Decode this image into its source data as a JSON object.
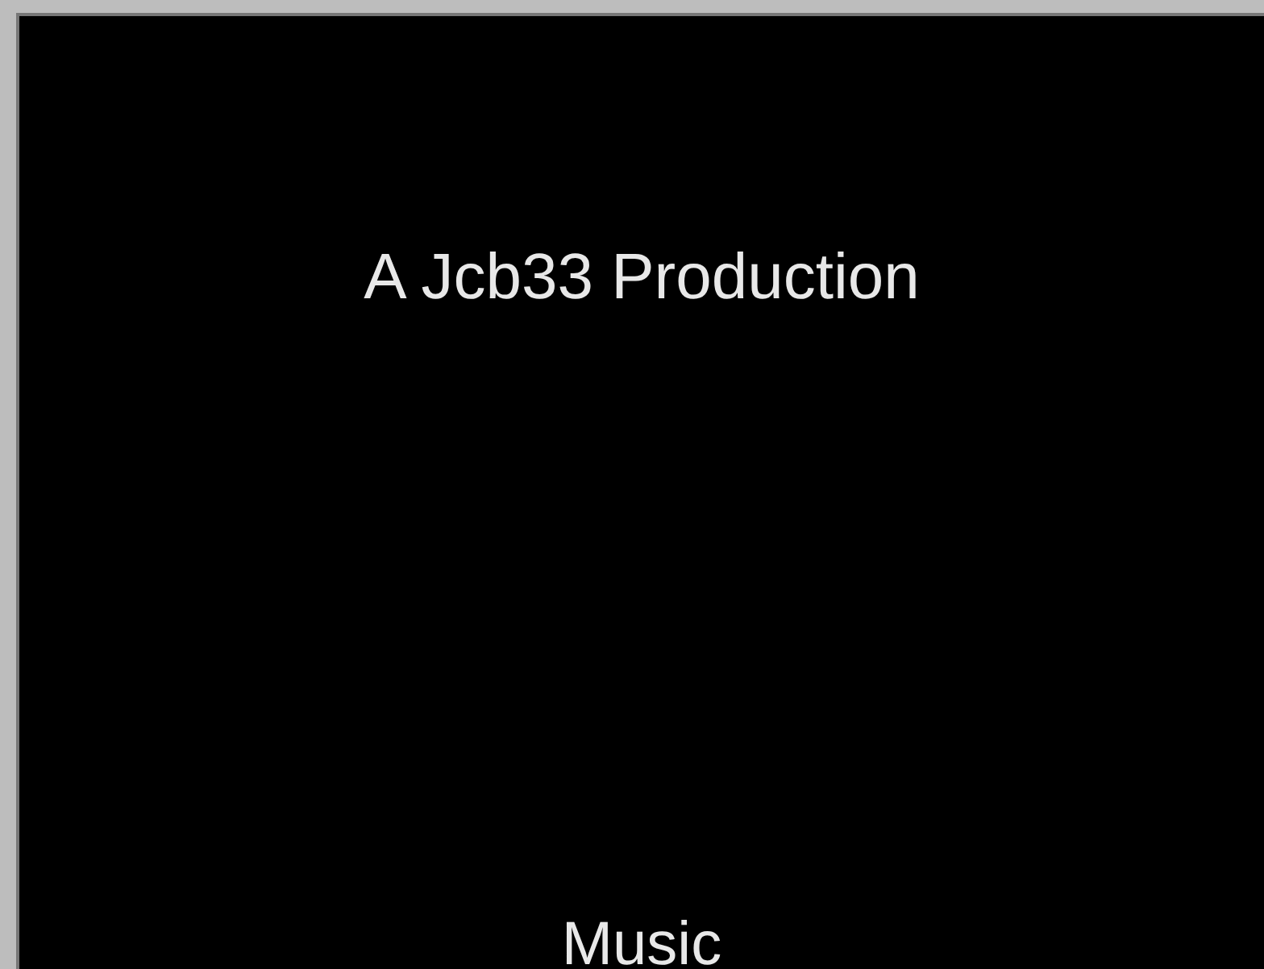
{
  "slide": {
    "title": "A Jcb33 Production",
    "caption": "Music"
  }
}
